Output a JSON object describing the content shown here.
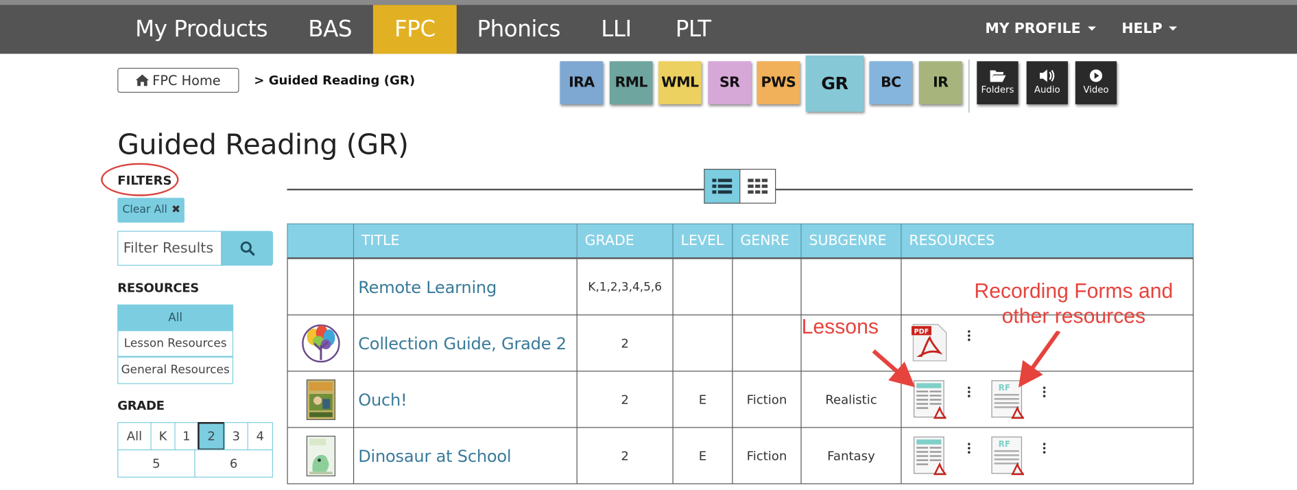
{
  "nav": {
    "tabs": [
      "My Products",
      "BAS",
      "FPC",
      "Phonics",
      "LLI",
      "PLT"
    ],
    "active_tab": "FPC",
    "profile_label": "MY PROFILE",
    "help_label": "HELP"
  },
  "breadcrumb": {
    "home_label": "FPC Home",
    "current": "> Guided Reading (GR)"
  },
  "category_tiles": [
    {
      "label": "IRA",
      "color": "#7ea7d2"
    },
    {
      "label": "RML",
      "color": "#6ea59f"
    },
    {
      "label": "WML",
      "color": "#ecd060"
    },
    {
      "label": "SR",
      "color": "#d6a8d8"
    },
    {
      "label": "PWS",
      "color": "#f1b05a"
    },
    {
      "label": "GR",
      "color": "#86c8d6",
      "active": true
    },
    {
      "label": "BC",
      "color": "#85b5dd"
    },
    {
      "label": "IR",
      "color": "#a7b57c"
    }
  ],
  "content_tiles": [
    {
      "label": "Folders",
      "icon": "folder-icon"
    },
    {
      "label": "Audio",
      "icon": "speaker-icon"
    },
    {
      "label": "Video",
      "icon": "play-icon"
    }
  ],
  "page": {
    "title": "Guided Reading (GR)"
  },
  "filters": {
    "label": "FILTERS",
    "clear_all": "Clear All",
    "search_placeholder": "Filter Results",
    "resources_heading": "RESOURCES",
    "resources": [
      "All",
      "Lesson Resources",
      "General Resources"
    ],
    "resources_selected": "All",
    "grade_heading": "GRADE",
    "grades_row1": [
      "All",
      "K",
      "1",
      "2",
      "3",
      "4"
    ],
    "grades_row2": [
      "5",
      "6"
    ],
    "grade_selected": "2"
  },
  "table": {
    "headers": [
      "",
      "TITLE",
      "GRADE",
      "LEVEL",
      "GENRE",
      "SUBGENRE",
      "RESOURCES"
    ],
    "rows": [
      {
        "title": "Remote Learning",
        "grade": "K,1,2,3,4,5,6",
        "level": "",
        "genre": "",
        "subgenre": "",
        "thumb": "none",
        "resources": "none"
      },
      {
        "title": "Collection Guide, Grade 2",
        "grade": "2",
        "level": "",
        "genre": "",
        "subgenre": "",
        "thumb": "tree",
        "resources": "pdf"
      },
      {
        "title": "Ouch!",
        "grade": "2",
        "level": "E",
        "genre": "Fiction",
        "subgenre": "Realistic",
        "thumb": "book-ouch",
        "resources": "lesson+rf"
      },
      {
        "title": "Dinosaur at School",
        "grade": "2",
        "level": "E",
        "genre": "Fiction",
        "subgenre": "Fantasy",
        "thumb": "book-dino",
        "resources": "lesson+rf"
      }
    ]
  },
  "annotations": {
    "lessons": "Lessons",
    "recording_forms_line1": "Recording Forms and",
    "recording_forms_line2": "other resources",
    "color": "#e6433d"
  }
}
